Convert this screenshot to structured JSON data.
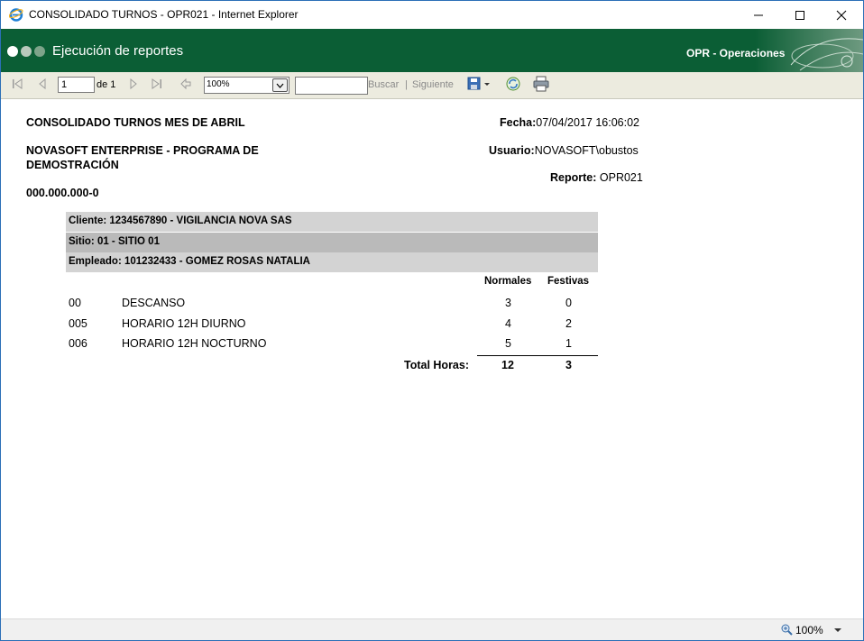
{
  "window": {
    "title": "CONSOLIDADO TURNOS - OPR021 - Internet Explorer",
    "minimize": "Minimize",
    "maximize": "Maximize",
    "close": "Close"
  },
  "header": {
    "title": "Ejecución de reportes",
    "module": "OPR - Operaciones",
    "brand_color": "#0b5e35"
  },
  "toolbar": {
    "page_value": "1",
    "of_label": "de 1",
    "zoom_value": "100%",
    "search_value": "",
    "find_label": "Buscar",
    "separator": "|",
    "next_label": "Siguiente"
  },
  "report": {
    "title": "CONSOLIDADO TURNOS MES DE ABRIL",
    "company_line1": "NOVASOFT ENTERPRISE - PROGRAMA DE",
    "company_line2": "DEMOSTRACIÓN",
    "nit": "000.000.000-0",
    "fecha_label": "Fecha:",
    "fecha_value": "07/04/2017 16:06:02",
    "usuario_label": "Usuario:",
    "usuario_value": "NOVASOFT\\obustos",
    "reporte_label": "Reporte:",
    "reporte_value": " OPR021",
    "cliente": "Cliente: 1234567890 - VIGILANCIA NOVA SAS",
    "sitio": "Sitio: 01 - SITIO 01",
    "empleado": "Empleado: 101232433     - GOMEZ ROSAS NATALIA",
    "col_normales": "Normales",
    "col_festivas": "Festivas",
    "rows": [
      {
        "code": "00",
        "name": "DESCANSO",
        "normales": "3",
        "festivas": "0"
      },
      {
        "code": "005",
        "name": "HORARIO  12H  DIURNO",
        "normales": "4",
        "festivas": "2"
      },
      {
        "code": "006",
        "name": "HORARIO  12H  NOCTURNO",
        "normales": "5",
        "festivas": "1"
      }
    ],
    "total_label": "Total Horas:",
    "total_normales": "12",
    "total_festivas": "3"
  },
  "statusbar": {
    "zoom": "100%"
  }
}
